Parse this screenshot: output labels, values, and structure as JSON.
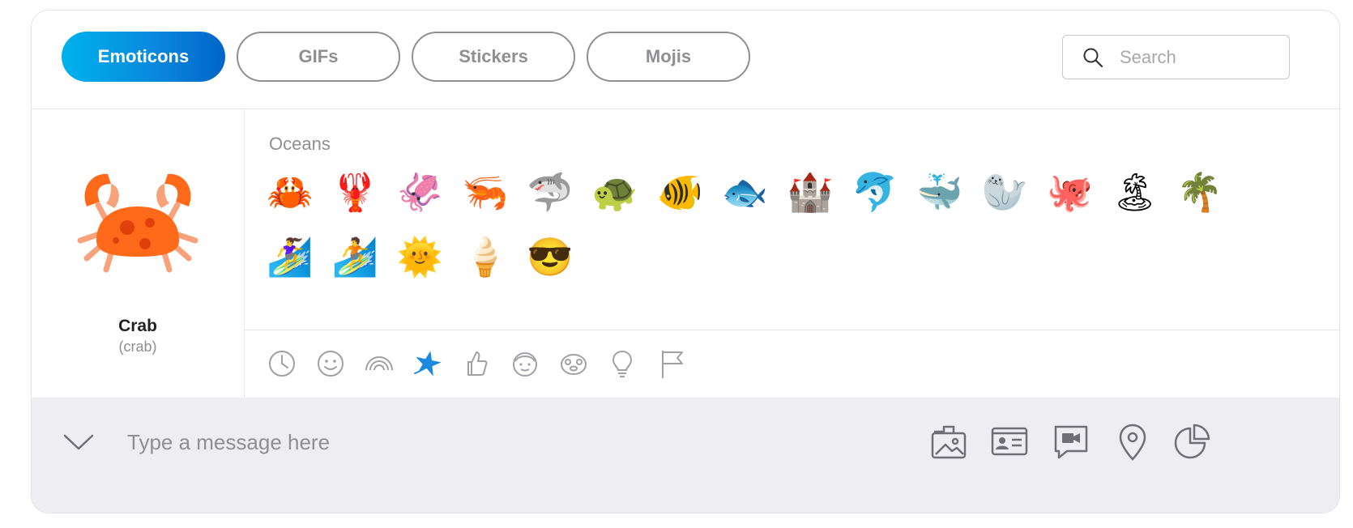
{
  "tabs": [
    {
      "label": "Emoticons",
      "active": true
    },
    {
      "label": "GIFs",
      "active": false
    },
    {
      "label": "Stickers",
      "active": false
    },
    {
      "label": "Mojis",
      "active": false
    }
  ],
  "search": {
    "placeholder": "Search"
  },
  "preview": {
    "name": "Crab",
    "code": "(crab)"
  },
  "category": {
    "title": "Oceans"
  },
  "emoticons": [
    {
      "name": "crab",
      "glyph": "🦀"
    },
    {
      "name": "lobster",
      "glyph": "🦞"
    },
    {
      "name": "squid",
      "glyph": "🦑"
    },
    {
      "name": "shrimp",
      "glyph": "🦐"
    },
    {
      "name": "shark",
      "glyph": "🦈"
    },
    {
      "name": "turtle",
      "glyph": "🐢"
    },
    {
      "name": "tropical-fish",
      "glyph": "🐠"
    },
    {
      "name": "fish",
      "glyph": "🐟"
    },
    {
      "name": "sandcastle",
      "glyph": "🏰"
    },
    {
      "name": "dolphin",
      "glyph": "🐬"
    },
    {
      "name": "whale",
      "glyph": "🐳"
    },
    {
      "name": "seal",
      "glyph": "🦭"
    },
    {
      "name": "octopus",
      "glyph": "🐙"
    },
    {
      "name": "island",
      "glyph": "🏝"
    },
    {
      "name": "palm-tree",
      "glyph": "🌴"
    },
    {
      "name": "woman-surfing",
      "glyph": "🏄‍♀️"
    },
    {
      "name": "man-surfing",
      "glyph": "🏄"
    },
    {
      "name": "sun",
      "glyph": "🌞"
    },
    {
      "name": "ice-cream",
      "glyph": "🍦"
    },
    {
      "name": "cool",
      "glyph": "😎"
    }
  ],
  "category_icons": [
    "recent-icon",
    "smiley-icon",
    "rainbow-icon",
    "starfish-icon",
    "thumbs-up-icon",
    "face-icon",
    "animal-icon",
    "lightbulb-icon",
    "flag-icon"
  ],
  "active_category": "starfish-icon",
  "composer": {
    "placeholder": "Type a message here"
  },
  "actions": [
    "gallery-icon",
    "contact-card-icon",
    "video-message-icon",
    "location-icon",
    "poll-icon"
  ],
  "colors": {
    "accent": "#0a86dc",
    "crab": "#ff6a1a",
    "crab_light": "#f7a27a"
  }
}
